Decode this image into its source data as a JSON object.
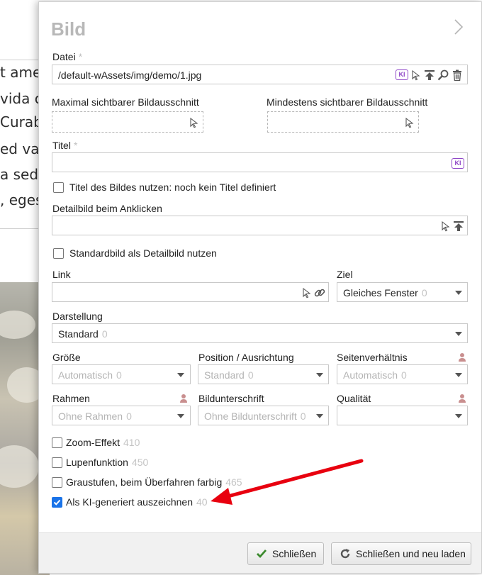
{
  "background": {
    "lines": [
      "t amet",
      "vida c",
      "Curab",
      "ed va",
      "a sed,",
      ", eges"
    ]
  },
  "dialog": {
    "title": "Bild",
    "datei": {
      "label": "Datei",
      "required_mark": "*",
      "value": "/default-wAssets/img/demo/1.jpg"
    },
    "max_crop_label": "Maximal sichtbarer Bildausschnitt",
    "min_crop_label": "Mindestens sichtbarer Bildausschnitt",
    "titel": {
      "label": "Titel",
      "required_mark": "*",
      "value": ""
    },
    "use_title_checkbox": {
      "label": "Titel des Bildes nutzen: noch kein Titel definiert",
      "checked": false
    },
    "detailbild_label": "Detailbild beim Anklicken",
    "standard_detail_checkbox": {
      "label": "Standardbild als Detailbild nutzen",
      "checked": false
    },
    "link_label": "Link",
    "ziel": {
      "label": "Ziel",
      "value": "Gleiches Fenster",
      "count": "0"
    },
    "darstellung": {
      "label": "Darstellung",
      "value": "Standard",
      "count": "0"
    },
    "groesse": {
      "label": "Größe",
      "value": "Automatisch",
      "count": "0"
    },
    "position": {
      "label": "Position / Ausrichtung",
      "value": "Standard",
      "count": "0"
    },
    "seitenverhaeltnis": {
      "label": "Seitenverhältnis",
      "value": "Automatisch",
      "count": "0"
    },
    "rahmen": {
      "label": "Rahmen",
      "value": "Ohne Rahmen",
      "count": "0"
    },
    "bildunterschrift": {
      "label": "Bildunterschrift",
      "value": "Ohne Bildunterschrift",
      "count": "0"
    },
    "qualitaet": {
      "label": "Qualität",
      "value": ""
    },
    "checkboxes": [
      {
        "label": "Zoom-Effekt",
        "count": "410",
        "checked": false
      },
      {
        "label": "Lupenfunktion",
        "count": "450",
        "checked": false
      },
      {
        "label": "Graustufen, beim Überfahren farbig",
        "count": "465",
        "checked": false
      },
      {
        "label": "Als KI-generiert auszeichnen",
        "count": "40",
        "checked": true
      }
    ],
    "buttons": {
      "close": "Schließen",
      "close_reload": "Schließen und neu laden"
    },
    "ki_badge": "KI"
  },
  "colors": {
    "accent_checkbox": "#1a73e8",
    "annotation_arrow": "#e8000f",
    "ki_purple": "#8f47c7"
  }
}
